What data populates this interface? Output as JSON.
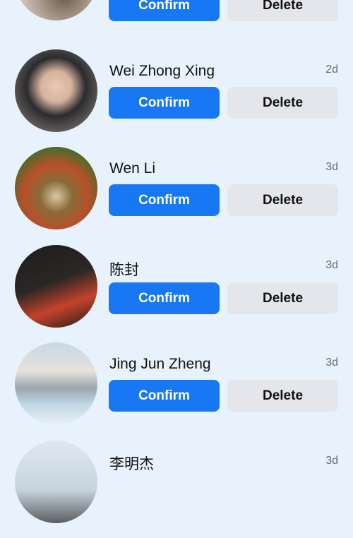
{
  "colors": {
    "background": "#e8f2fd",
    "confirm_bg": "#1877f2",
    "delete_bg": "#e4e6eb"
  },
  "requests": [
    {
      "name": "",
      "time": "",
      "confirm_label": "Confirm",
      "delete_label": "Delete",
      "avatar": "person-holding-jar-photo"
    },
    {
      "name": "Wei Zhong Xing",
      "time": "2d",
      "confirm_label": "Confirm",
      "delete_label": "Delete",
      "avatar": "young-man-selfie-photo"
    },
    {
      "name": "Wen Li",
      "time": "3d",
      "confirm_label": "Confirm",
      "delete_label": "Delete",
      "avatar": "autumn-trees-path-photo"
    },
    {
      "name": "陈封",
      "time": "3d",
      "confirm_label": "Confirm",
      "delete_label": "Delete",
      "avatar": "book-and-wine-glass-photo"
    },
    {
      "name": "Jing Jun Zheng",
      "time": "3d",
      "confirm_label": "Confirm",
      "delete_label": "Delete",
      "avatar": "ice-sculpture-building-photo"
    },
    {
      "name": "李明杰",
      "time": "3d",
      "avatar": "person-sky-photo"
    }
  ]
}
